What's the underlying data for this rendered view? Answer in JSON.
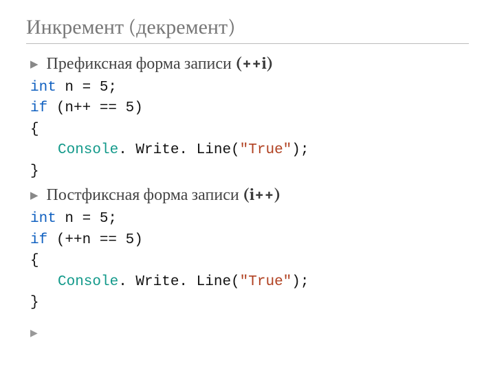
{
  "title": "Инкремент (декремент)",
  "bullet1": {
    "prefix": "Префиксная форма записи ",
    "suffix": "(++i)"
  },
  "code1": {
    "l1_kw": "int",
    "l1_rest": " n = 5;",
    "l2_kw": "if",
    "l2_rest": " (n++ == 5)",
    "l3": "{",
    "l4_cls": "Console",
    "l4_mid": ". Write. Line(",
    "l4_str": "\"True\"",
    "l4_end": ");",
    "l5": "}"
  },
  "bullet2": {
    "prefix": "Постфиксная форма записи ",
    "suffix": "(i++)"
  },
  "code2": {
    "l1_kw": "int",
    "l1_rest": " n = 5;",
    "l2_kw": "if",
    "l2_rest": " (++n == 5)",
    "l3": "{",
    "l4_cls": "Console",
    "l4_mid": ". Write. Line(",
    "l4_str": "\"True\"",
    "l4_end": ");",
    "l5": "}"
  },
  "marker": "▶"
}
